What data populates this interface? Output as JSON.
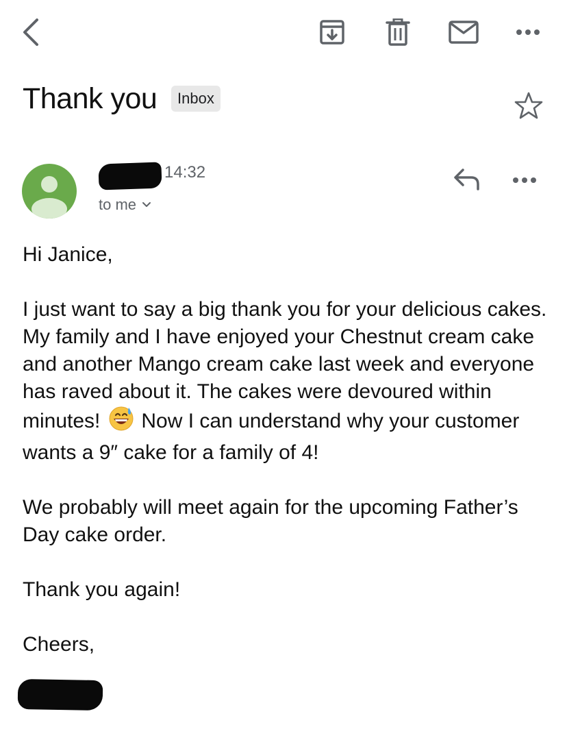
{
  "toolbar": {
    "icons": [
      "back-arrow-icon",
      "archive-icon",
      "trash-icon",
      "mail-unread-icon",
      "more-horizontal-icon"
    ]
  },
  "email": {
    "subject": "Thank you",
    "label": "Inbox",
    "time": "14:32",
    "recipient": "to me",
    "avatar_color": "#6aaa4b",
    "greeting": "Hi Janice,",
    "paragraph1_a": "I just want to say a big thank you for your delicious cakes. My family and I have enjoyed your Chestnut cream cake and another Mango cream cake last week and everyone has raved about it. The cakes were devoured within minutes!",
    "paragraph1_b": "Now I can understand why your customer wants a 9″ cake for a family of 4!",
    "paragraph2": "We probably will meet again for the upcoming Father’s Day cake order.",
    "paragraph3": "Thank you again!",
    "signoff": "Cheers,"
  }
}
